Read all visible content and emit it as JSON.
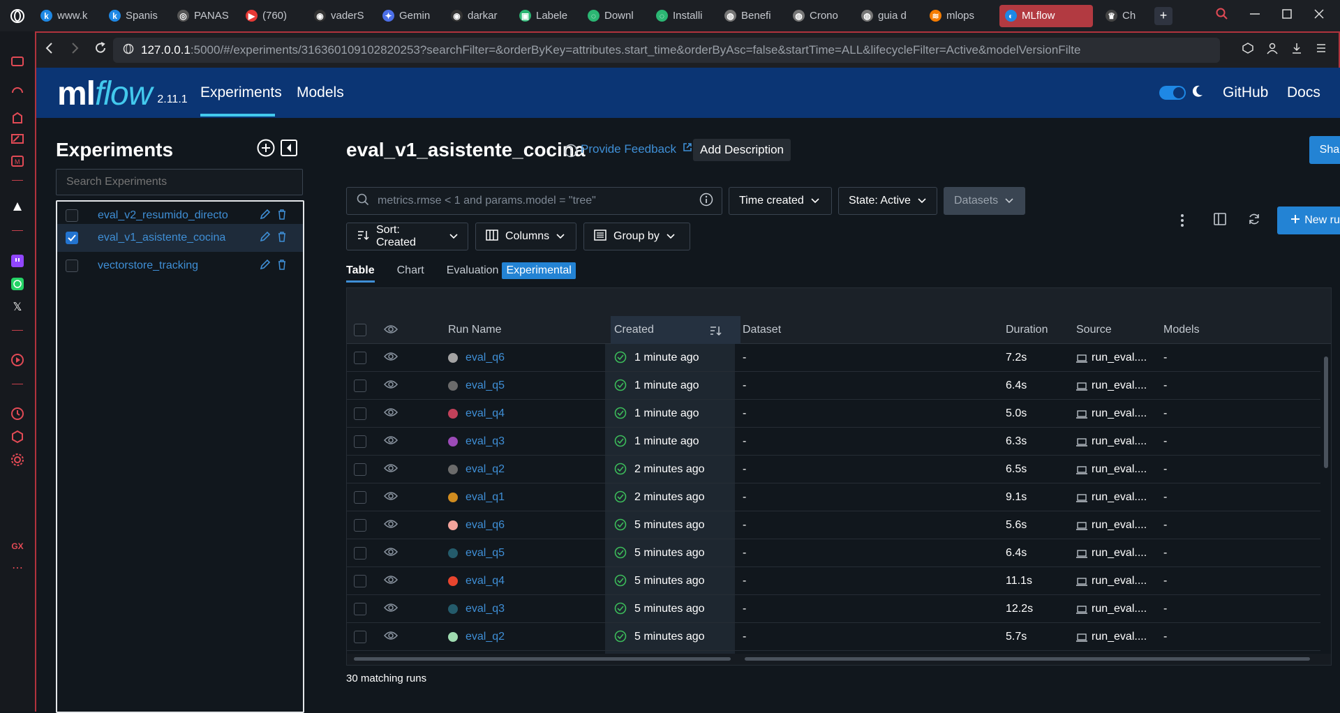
{
  "browser": {
    "tabs": [
      {
        "label": "www.k",
        "fav": "k",
        "color": "#1e88e5"
      },
      {
        "label": "Spanis",
        "fav": "k",
        "color": "#1e88e5"
      },
      {
        "label": "PANAS",
        "fav": "◎",
        "color": "#555"
      },
      {
        "label": "(760) ",
        "fav": "▶",
        "color": "#e53935"
      },
      {
        "label": "vaderS",
        "fav": "◉",
        "color": "#333"
      },
      {
        "label": "Gemin",
        "fav": "✦",
        "color": "#4c6fe8"
      },
      {
        "label": "darkar",
        "fav": "◉",
        "color": "#333"
      },
      {
        "label": "Labele",
        "fav": "▣",
        "color": "#2bb673"
      },
      {
        "label": "Downl",
        "fav": "◌",
        "color": "#2bb673"
      },
      {
        "label": "Installi",
        "fav": "◌",
        "color": "#2bb673"
      },
      {
        "label": "Benefi",
        "fav": "◍",
        "color": "#777"
      },
      {
        "label": "Crono",
        "fav": "◍",
        "color": "#777"
      },
      {
        "label": "guia d",
        "fav": "◍",
        "color": "#777"
      },
      {
        "label": "mlops",
        "fav": "≋",
        "color": "#f57c00"
      }
    ],
    "active_tab": "MLflow",
    "extra_tab": "Ch",
    "url_host": "127.0.0.1",
    "url_rest": ":5000/#/experiments/316360109102820253?searchFilter=&orderByKey=attributes.start_time&orderByAsc=false&startTime=ALL&lifecycleFilter=Active&modelVersionFilte",
    "side_bottom_label": "GX"
  },
  "header": {
    "logo_ml": "ml",
    "logo_flow": "flow",
    "version": "2.11.1",
    "nav_experiments": "Experiments",
    "nav_models": "Models",
    "github": "GitHub",
    "docs": "Docs"
  },
  "sidebar": {
    "title": "Experiments",
    "search_placeholder": "Search Experiments",
    "items": [
      {
        "name": "eval_v2_resumido_directo",
        "checked": false
      },
      {
        "name": "eval_v1_asistente_cocina",
        "checked": true
      },
      {
        "name": "vectorstore_tracking",
        "checked": false
      }
    ]
  },
  "main": {
    "title": "eval_v1_asistente_cocina",
    "feedback": "Provide Feedback",
    "add_description": "Add Description",
    "share": "Share",
    "search_placeholder": "metrics.rmse < 1 and params.model = \"tree\"",
    "time_filter": "Time created",
    "state_filter": "State: Active",
    "datasets_filter": "Datasets",
    "sort": "Sort: Created",
    "columns": "Columns",
    "group_by": "Group by",
    "new_run": "New run",
    "tabs": [
      "Table",
      "Chart",
      "Evaluation"
    ],
    "experimental_badge": "Experimental",
    "matching": "30 matching runs"
  },
  "table": {
    "headers": {
      "run_name": "Run Name",
      "created": "Created",
      "dataset": "Dataset",
      "duration": "Duration",
      "source": "Source",
      "models": "Models"
    },
    "rows": [
      {
        "name": "eval_q6",
        "color": "#a3a3a3",
        "created": "1 minute ago",
        "dataset": "-",
        "duration": "7.2s",
        "source": "run_eval....",
        "models": "-"
      },
      {
        "name": "eval_q5",
        "color": "#6b6b6b",
        "created": "1 minute ago",
        "dataset": "-",
        "duration": "6.4s",
        "source": "run_eval....",
        "models": "-"
      },
      {
        "name": "eval_q4",
        "color": "#c2415a",
        "created": "1 minute ago",
        "dataset": "-",
        "duration": "5.0s",
        "source": "run_eval....",
        "models": "-"
      },
      {
        "name": "eval_q3",
        "color": "#9c4bb8",
        "created": "1 minute ago",
        "dataset": "-",
        "duration": "6.3s",
        "source": "run_eval....",
        "models": "-"
      },
      {
        "name": "eval_q2",
        "color": "#6b6b6b",
        "created": "2 minutes ago",
        "dataset": "-",
        "duration": "6.5s",
        "source": "run_eval....",
        "models": "-"
      },
      {
        "name": "eval_q1",
        "color": "#d18c1f",
        "created": "2 minutes ago",
        "dataset": "-",
        "duration": "9.1s",
        "source": "run_eval....",
        "models": "-"
      },
      {
        "name": "eval_q6",
        "color": "#f2a39b",
        "created": "5 minutes ago",
        "dataset": "-",
        "duration": "5.6s",
        "source": "run_eval....",
        "models": "-"
      },
      {
        "name": "eval_q5",
        "color": "#245b6b",
        "created": "5 minutes ago",
        "dataset": "-",
        "duration": "6.4s",
        "source": "run_eval....",
        "models": "-"
      },
      {
        "name": "eval_q4",
        "color": "#e8452e",
        "created": "5 minutes ago",
        "dataset": "-",
        "duration": "11.1s",
        "source": "run_eval....",
        "models": "-"
      },
      {
        "name": "eval_q3",
        "color": "#245b6b",
        "created": "5 minutes ago",
        "dataset": "-",
        "duration": "12.2s",
        "source": "run_eval....",
        "models": "-"
      },
      {
        "name": "eval_q2",
        "color": "#9fdbb0",
        "created": "5 minutes ago",
        "dataset": "-",
        "duration": "5.7s",
        "source": "run_eval....",
        "models": "-"
      }
    ]
  }
}
